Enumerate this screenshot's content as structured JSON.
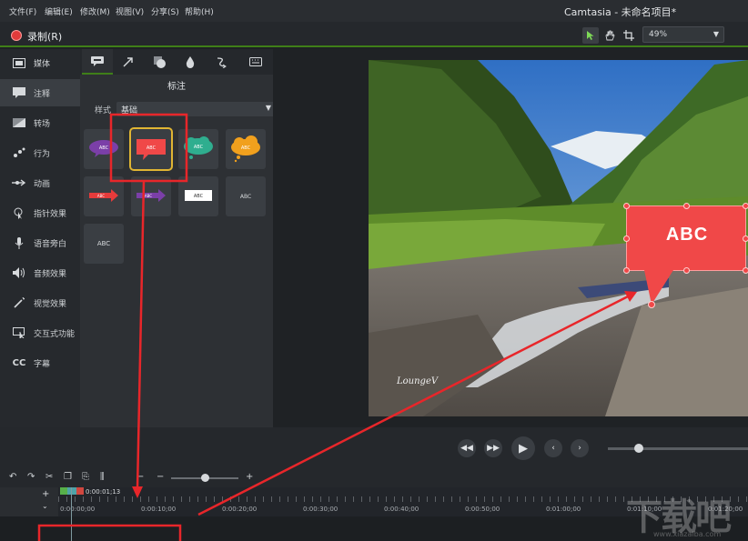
{
  "menubar": {
    "items": [
      "文件(F)",
      "编辑(E)",
      "修改(M)",
      "视图(V)",
      "分享(S)",
      "帮助(H)"
    ],
    "title": "Camtasia - 未命名项目*"
  },
  "toolbar": {
    "record_label": "录制(R)",
    "zoom_value": "49%",
    "tools": [
      "arrow-icon",
      "hand-icon",
      "crop-icon"
    ]
  },
  "sidebar": {
    "items": [
      {
        "label": "媒体",
        "icon": "media-icon",
        "active": false
      },
      {
        "label": "注释",
        "icon": "annotation-icon",
        "active": true
      },
      {
        "label": "转场",
        "icon": "transition-icon",
        "active": false
      },
      {
        "label": "行为",
        "icon": "behavior-icon",
        "active": false
      },
      {
        "label": "动画",
        "icon": "animation-icon",
        "active": false
      },
      {
        "label": "指针效果",
        "icon": "cursor-effect-icon",
        "active": false
      },
      {
        "label": "语音旁白",
        "icon": "microphone-icon",
        "active": false
      },
      {
        "label": "音频效果",
        "icon": "audio-effect-icon",
        "active": false
      },
      {
        "label": "视觉效果",
        "icon": "visual-effect-icon",
        "active": false
      },
      {
        "label": "交互式功能",
        "icon": "interactive-icon",
        "active": false
      },
      {
        "label": "字幕",
        "icon": "captions-icon",
        "active": false
      }
    ]
  },
  "panel": {
    "tabs": [
      "callout-tab-icon",
      "arrow-tab-icon",
      "shape-tab-icon",
      "blur-tab-icon",
      "sketch-tab-icon",
      "keystroke-tab-icon"
    ],
    "title": "标注",
    "style_label": "样式",
    "style_value": "基础",
    "tile_text": "ABC"
  },
  "canvas": {
    "callout_text": "ABC",
    "logo_text": "LoungeV"
  },
  "timeline": {
    "playhead_time": "0:00:01;13",
    "ruler_labels": [
      "0:00:00;00",
      "0:00:10;00",
      "0:00:20;00",
      "0:00:30;00",
      "0:00:40;00",
      "0:00:50;00",
      "0:01:00;00",
      "0:01:10;00",
      "0:01:20;00"
    ]
  },
  "watermark": {
    "text": "下载吧",
    "domain": "www.xiazaiba.com"
  },
  "colors": {
    "accent_green": "#3f7f18",
    "callout_red": "#f04848",
    "annotation_red": "#e8262a",
    "selection_yellow": "#e0b533"
  }
}
